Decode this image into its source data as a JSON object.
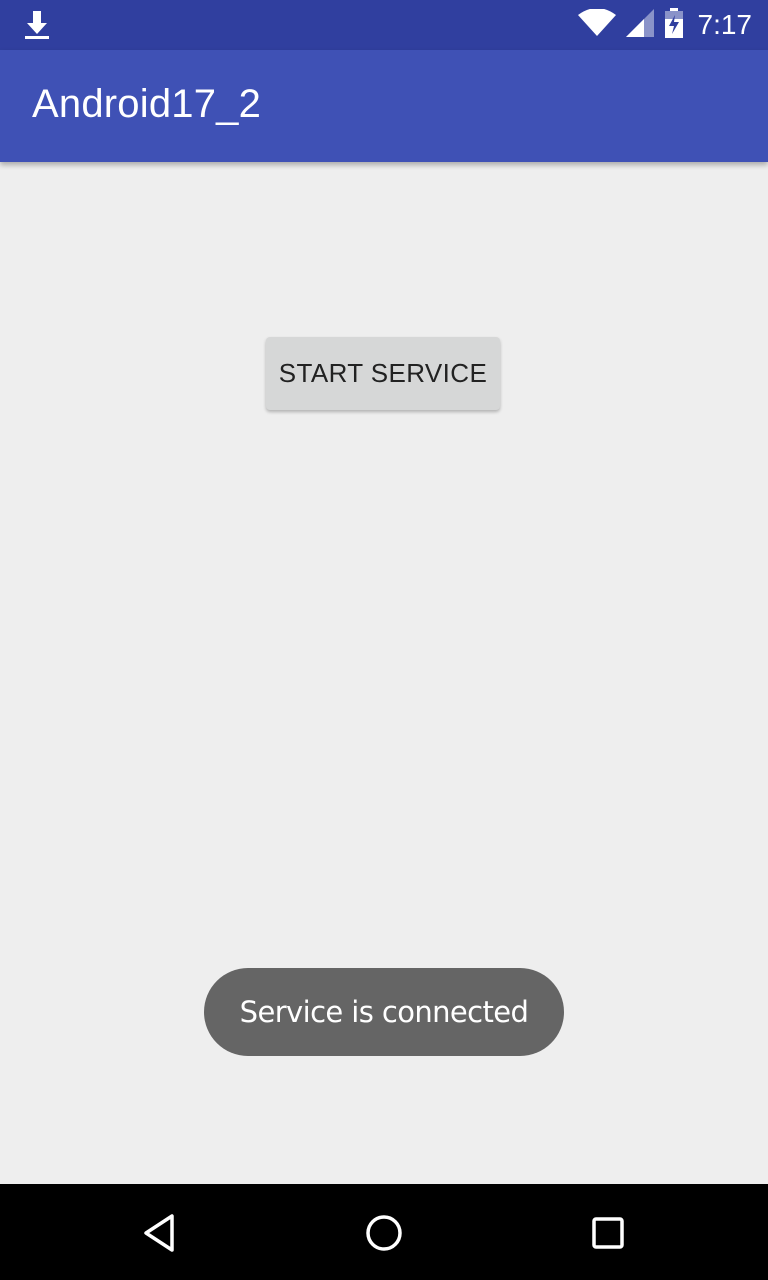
{
  "status_bar": {
    "time": "7:17",
    "icons": [
      "download-icon",
      "wifi-icon",
      "cellular-signal-icon",
      "battery-charging-icon"
    ],
    "color": "#303f9f"
  },
  "app_bar": {
    "title": "Android17_2",
    "color": "#3f51b5"
  },
  "main": {
    "start_button_label": "START SERVICE"
  },
  "toast": {
    "message": "Service is connected"
  },
  "nav_bar": {
    "buttons": [
      "back-icon",
      "home-icon",
      "recents-icon"
    ]
  }
}
